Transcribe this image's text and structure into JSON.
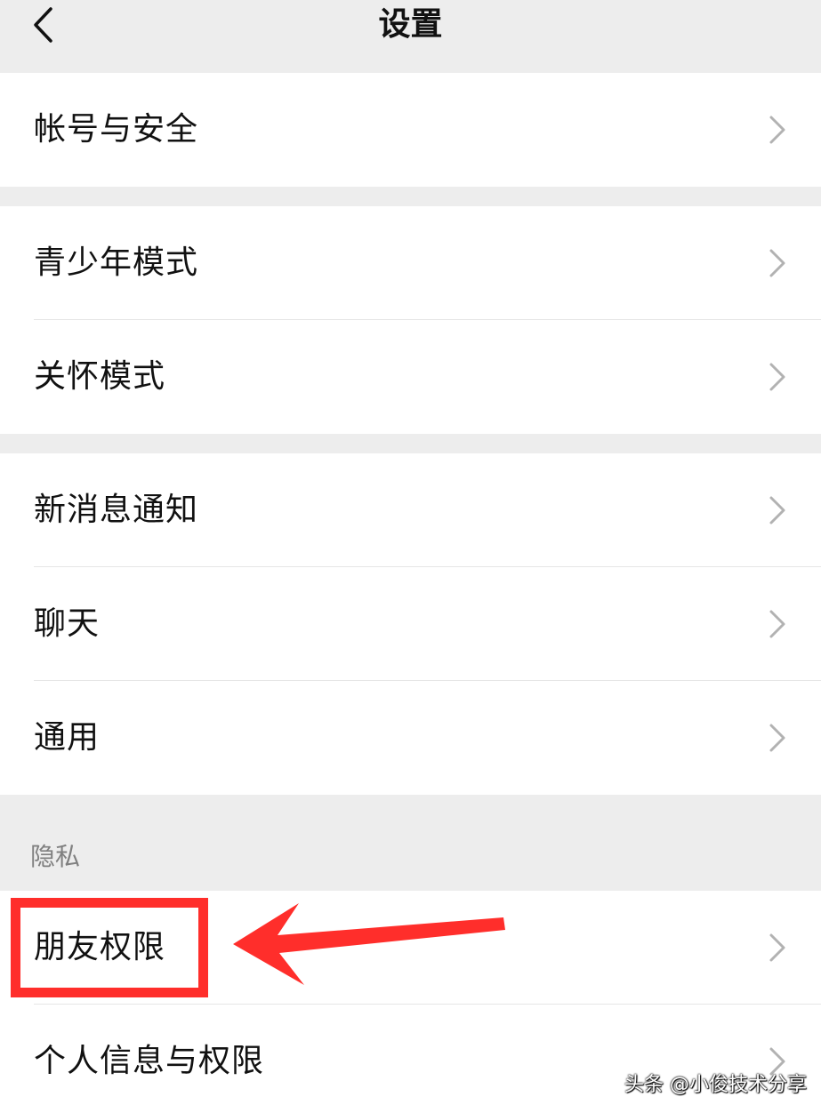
{
  "nav": {
    "title": "设置",
    "back_icon": "chevron-left-icon"
  },
  "groups": [
    {
      "items": [
        {
          "label": "帐号与安全"
        }
      ]
    },
    {
      "items": [
        {
          "label": "青少年模式"
        },
        {
          "label": "关怀模式"
        }
      ]
    },
    {
      "items": [
        {
          "label": "新消息通知"
        },
        {
          "label": "聊天"
        },
        {
          "label": "通用"
        }
      ]
    }
  ],
  "privacy": {
    "header": "隐私",
    "items": [
      {
        "label": "朋友权限"
      },
      {
        "label": "个人信息与权限"
      }
    ]
  },
  "annotation": {
    "color": "#ff2e2b"
  },
  "watermark": "头条 @小俊技术分享",
  "colors": {
    "page_bg": "#ededed",
    "cell_bg": "#ffffff",
    "chevron": "#b2b2b2"
  }
}
